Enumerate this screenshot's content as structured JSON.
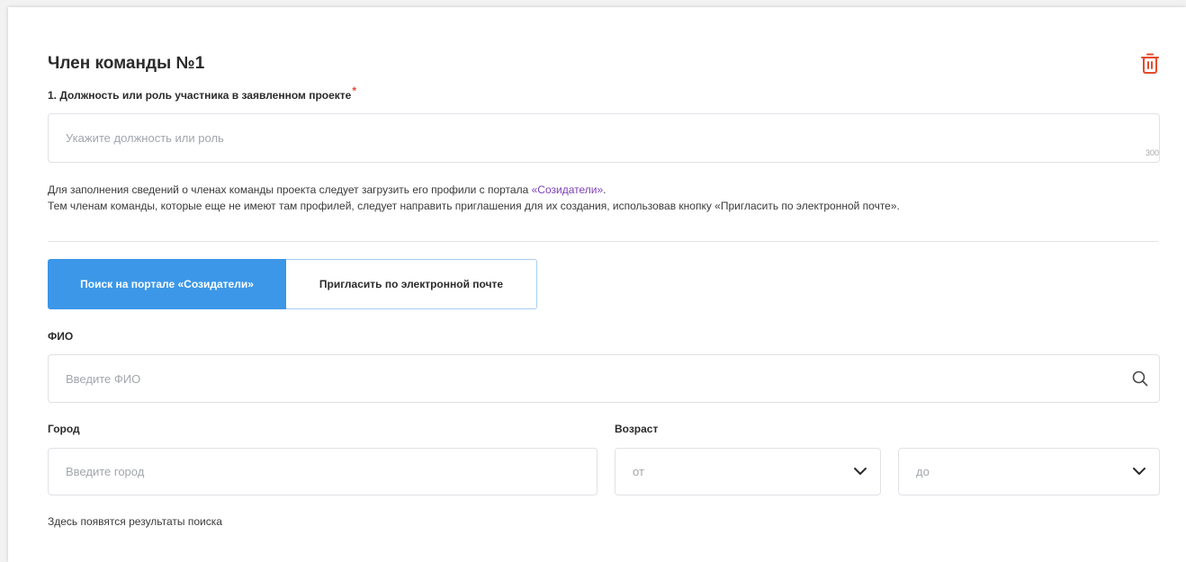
{
  "member": {
    "title": "Член команды №1",
    "delete_icon": "trash-icon"
  },
  "role": {
    "label": "1. Должность или роль участника в заявленном проекте",
    "required_mark": "*",
    "placeholder": "Укажите должность или роль",
    "value": "",
    "max_length": "300"
  },
  "info": {
    "line1_prefix": "Для заполнения сведений о членах команды проекта следует загрузить его профили с портала ",
    "line1_link": "«Созидатели»",
    "line1_suffix": ".",
    "line2": "Тем членам команды, которые еще не имеют там профилей, следует направить приглашения для их создания, использовав кнопку «Пригласить по электронной почте»."
  },
  "tabs": [
    {
      "label": "Поиск на портале «Созидатели»",
      "active": true
    },
    {
      "label": "Пригласить по электронной почте",
      "active": false
    }
  ],
  "fio": {
    "label": "ФИО",
    "placeholder": "Введите ФИО",
    "icon": "search-icon"
  },
  "city": {
    "label": "Город",
    "placeholder": "Введите город"
  },
  "age": {
    "label": "Возраст",
    "from_placeholder": "от",
    "to_placeholder": "до",
    "icon": "chevron-down-icon"
  },
  "results": {
    "empty_text": "Здесь появятся результаты поиска"
  },
  "colors": {
    "accent": "#3c97e8",
    "link": "#7b3fb7",
    "danger": "#e8492b"
  }
}
